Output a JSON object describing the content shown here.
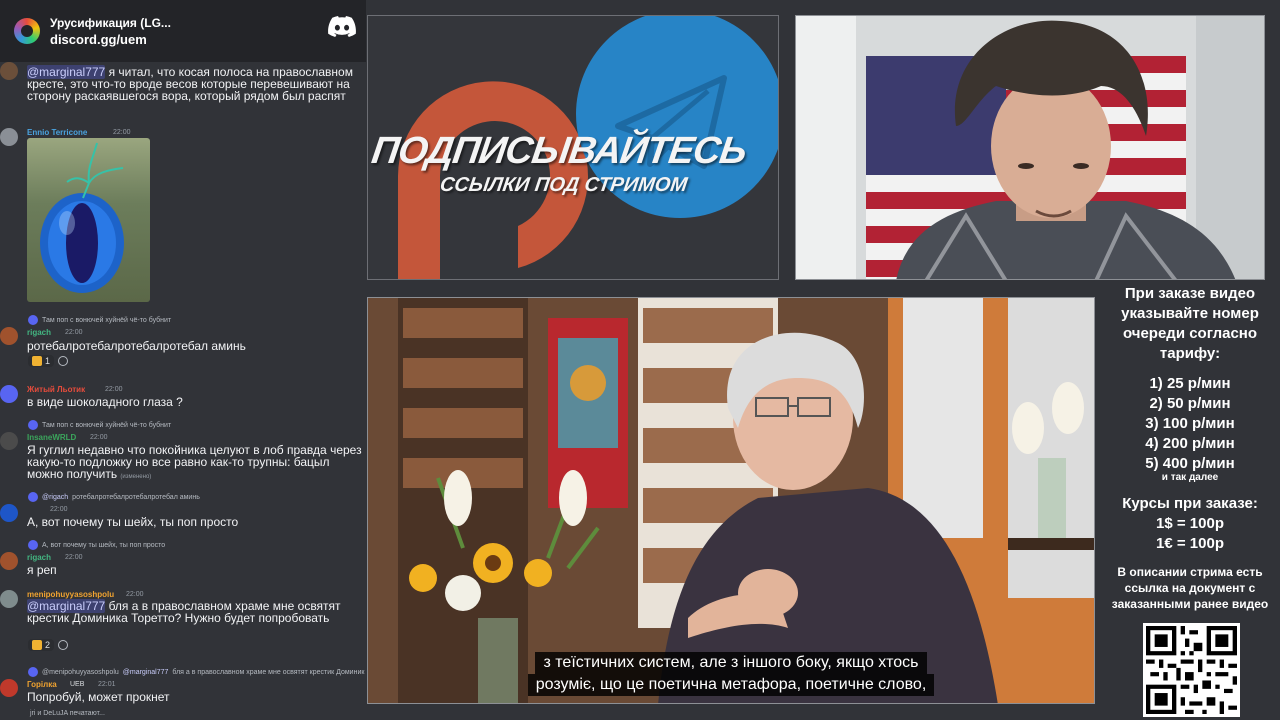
{
  "server": {
    "name": "Урусификация (LG...",
    "invite": "discord.gg/uem"
  },
  "colors": {
    "chat_bg": "#313338",
    "banner_bg": "#232428",
    "mention": "#c9cdfb",
    "discord_blurple": "#5865f2"
  },
  "chat": {
    "messages": [
      {
        "mention": "@marginal777",
        "text": " я читал, что косая полоса на православном кресте, это что-то вроде весов которые перевешивают на сторону раскаявшегося вора, который рядом был распят"
      },
      {
        "user": "Ennio Terricone",
        "time": "22:00",
        "user_color": "#4aa3df",
        "image": "blue-eye-pendant"
      },
      {
        "reply": "Там поп с вонючей хуйнёй чё-то бубнит",
        "user": "rigach",
        "time": "22:00",
        "user_color": "#43b581",
        "text": "ротебалротебалротебалротебал аминь",
        "reaction_count": "1"
      },
      {
        "user": "Житый Льотик",
        "time": "22:00",
        "user_color": "#e74c3c",
        "text": "в виде шоколадного глаза ?"
      },
      {
        "reply": "Там поп с вонючей хуйнёй чё-то бубнит",
        "user": "InsaneWRLD",
        "time": "22:00",
        "user_color": "#3ba55c",
        "text": "Я гуглил недавно что покойника целуют в лоб правда через какую-то подложку но все равно как-то трупны: бацыл можно получить",
        "edited": "(изменено)"
      },
      {
        "reply_user": "@rigach",
        "reply": "ротебалротебалротебалротебал аминь",
        "time": "22:00",
        "text": "А, вот почему ты шейх, ты поп просто"
      },
      {
        "reply": "А, вот почему ты шейх, ты поп просто",
        "user": "rigach",
        "time": "22:00",
        "user_color": "#43b581",
        "text": "я реп"
      },
      {
        "user": "menipohuyyasoshpolu",
        "time": "22:00",
        "user_color": "#f0a330",
        "mention": "@marginal777",
        "text": " бля а в православном храме мне освятят крестик Доминика Торетто? Нужно будет попробовать",
        "reaction_count": "2"
      },
      {
        "reply_user": "@menipohuyyasoshpolu",
        "reply_mention": "@marginal777",
        "reply": "бля а в православном храме мне освятят крестик Доминик",
        "user": "Горілка",
        "badge": "UEB",
        "time": "22:01",
        "user_color": "#f0a330",
        "text": "Попробуй, может прокнет"
      }
    ],
    "typing": "jri и DeLuJA печатают..."
  },
  "promo": {
    "title": "ПОДПИСЫВАЙТЕСЬ",
    "subtitle": "ССЫЛКИ ПОД СТРИМОМ"
  },
  "video": {
    "subtitle_line1": "з теїстичних систем, але з іншого боку, якщо хтось",
    "subtitle_line2": "розуміє, що це поетична метафора, поетичне слово,"
  },
  "info": {
    "order_heading": "При заказе видео указывайте номер очереди согласно тарифу:",
    "tariffs": [
      "1) 25 р/мин",
      "2) 50 р/мин",
      "3) 100 р/мин",
      "4) 200 р/мин",
      "5) 400 р/мин"
    ],
    "tariff_more": "и так далее",
    "courses_heading": "Курсы при заказе:",
    "courses": [
      "1$ = 100р",
      "1€ = 100р"
    ],
    "doc_note": "В описании стрима есть ссылка на документ с заказанными ранее видео"
  }
}
